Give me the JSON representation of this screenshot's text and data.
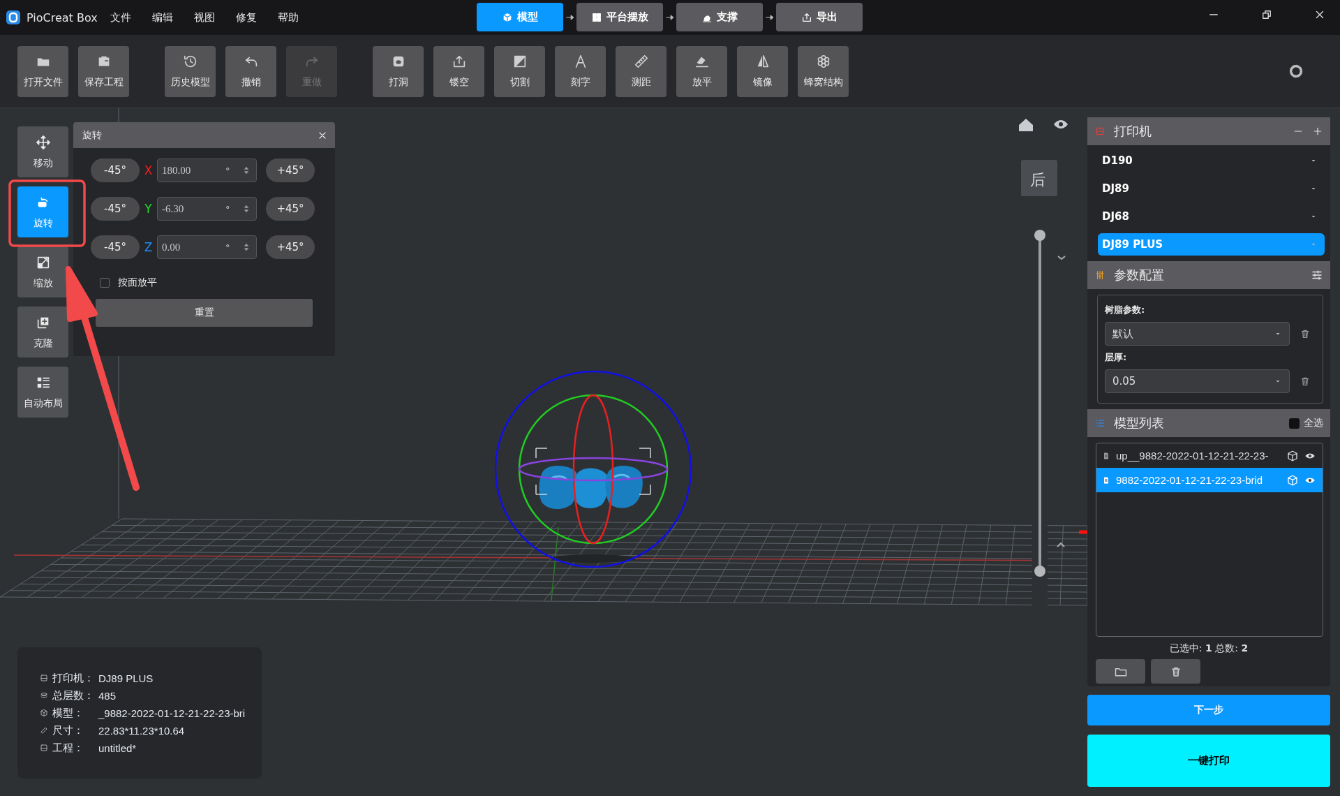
{
  "app": {
    "title": "PioCreat Box"
  },
  "menu": [
    "文件",
    "编辑",
    "视图",
    "修复",
    "帮助"
  ],
  "steps": [
    {
      "label": "模型",
      "selected": true
    },
    {
      "label": "平台摆放",
      "selected": false
    },
    {
      "label": "支撑",
      "selected": false
    },
    {
      "label": "导出",
      "selected": false
    }
  ],
  "toolbar": {
    "groups": [
      {
        "items": [
          {
            "label": "打开文件",
            "disabled": false
          },
          {
            "label": "保存工程",
            "disabled": false
          }
        ]
      },
      {
        "items": [
          {
            "label": "历史模型",
            "disabled": false
          },
          {
            "label": "撤销",
            "disabled": false
          },
          {
            "label": "重做",
            "disabled": true
          }
        ]
      },
      {
        "items": [
          {
            "label": "打洞",
            "disabled": false
          },
          {
            "label": "镂空",
            "disabled": false
          },
          {
            "label": "切割",
            "disabled": false
          },
          {
            "label": "刻字",
            "disabled": false
          },
          {
            "label": "测距",
            "disabled": false
          },
          {
            "label": "放平",
            "disabled": false
          },
          {
            "label": "镜像",
            "disabled": false
          },
          {
            "label": "蜂窝结构",
            "disabled": false
          }
        ]
      }
    ]
  },
  "tools": [
    {
      "label": "移动",
      "selected": false
    },
    {
      "label": "旋转",
      "selected": true
    },
    {
      "label": "缩放",
      "selected": false
    },
    {
      "label": "克隆",
      "selected": false
    },
    {
      "label": "自动布局",
      "selected": false
    }
  ],
  "rotate_dialog": {
    "title": "旋转",
    "axes": [
      {
        "axis": "X",
        "color": "#ff1a1a",
        "value": "180.00",
        "unit": "°",
        "minus": "-45°",
        "plus": "+45°"
      },
      {
        "axis": "Y",
        "color": "#22dd22",
        "value": "-6.30",
        "unit": "°",
        "minus": "-45°",
        "plus": "+45°"
      },
      {
        "axis": "Z",
        "color": "#1e8fff",
        "value": "0.00",
        "unit": "°",
        "minus": "-45°",
        "plus": "+45°"
      }
    ],
    "flatten": {
      "label": "按面放平",
      "checked": false
    },
    "reset": "重置"
  },
  "view_cube": {
    "face": "后"
  },
  "layer_slider": {
    "level": 1
  },
  "printer": {
    "title": "打印机",
    "models": [
      {
        "name": "D190",
        "selected": false
      },
      {
        "name": "DJ89",
        "selected": false
      },
      {
        "name": "DJ68",
        "selected": false
      },
      {
        "name": "DJ89 PLUS",
        "selected": true
      }
    ]
  },
  "params": {
    "title": "参数配置",
    "resin_label": "树脂参数:",
    "resin": "默认",
    "layer_label": "层厚:",
    "layer": "0.05"
  },
  "models": {
    "title": "模型列表",
    "select_all": {
      "label": "全选",
      "checked": false
    },
    "items": [
      {
        "name": "up__9882-2022-01-12-21-22-23-",
        "selected": false
      },
      {
        "name": "9882-2022-01-12-21-22-23-brid",
        "selected": true
      }
    ],
    "status": "已选中: **1** 总数: **2**"
  },
  "buttons": {
    "next": "下一步",
    "print": "一键打印"
  },
  "info": [
    {
      "label": "打印机：",
      "value": "DJ89 PLUS"
    },
    {
      "label": "总层数：",
      "value": "485"
    },
    {
      "label": "模型：",
      "value": "_9882-2022-01-12-21-22-23-bri"
    },
    {
      "label": "尺寸：",
      "value": "22.83*11.23*10.64"
    },
    {
      "label": "工程：",
      "value": "untitled*"
    }
  ]
}
